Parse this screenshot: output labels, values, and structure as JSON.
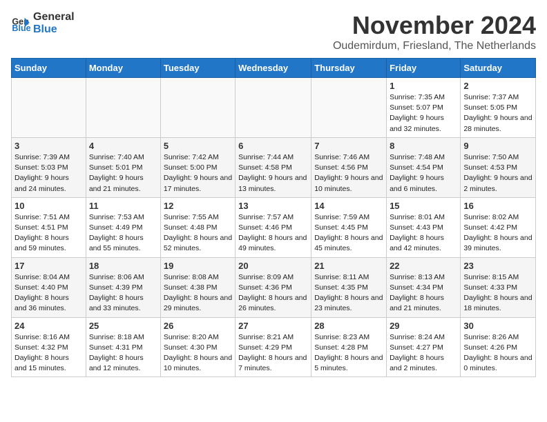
{
  "logo": {
    "line1": "General",
    "line2": "Blue"
  },
  "title": "November 2024",
  "subtitle": "Oudemirdum, Friesland, The Netherlands",
  "weekdays": [
    "Sunday",
    "Monday",
    "Tuesday",
    "Wednesday",
    "Thursday",
    "Friday",
    "Saturday"
  ],
  "weeks": [
    [
      {
        "day": "",
        "info": ""
      },
      {
        "day": "",
        "info": ""
      },
      {
        "day": "",
        "info": ""
      },
      {
        "day": "",
        "info": ""
      },
      {
        "day": "",
        "info": ""
      },
      {
        "day": "1",
        "info": "Sunrise: 7:35 AM\nSunset: 5:07 PM\nDaylight: 9 hours and 32 minutes."
      },
      {
        "day": "2",
        "info": "Sunrise: 7:37 AM\nSunset: 5:05 PM\nDaylight: 9 hours and 28 minutes."
      }
    ],
    [
      {
        "day": "3",
        "info": "Sunrise: 7:39 AM\nSunset: 5:03 PM\nDaylight: 9 hours and 24 minutes."
      },
      {
        "day": "4",
        "info": "Sunrise: 7:40 AM\nSunset: 5:01 PM\nDaylight: 9 hours and 21 minutes."
      },
      {
        "day": "5",
        "info": "Sunrise: 7:42 AM\nSunset: 5:00 PM\nDaylight: 9 hours and 17 minutes."
      },
      {
        "day": "6",
        "info": "Sunrise: 7:44 AM\nSunset: 4:58 PM\nDaylight: 9 hours and 13 minutes."
      },
      {
        "day": "7",
        "info": "Sunrise: 7:46 AM\nSunset: 4:56 PM\nDaylight: 9 hours and 10 minutes."
      },
      {
        "day": "8",
        "info": "Sunrise: 7:48 AM\nSunset: 4:54 PM\nDaylight: 9 hours and 6 minutes."
      },
      {
        "day": "9",
        "info": "Sunrise: 7:50 AM\nSunset: 4:53 PM\nDaylight: 9 hours and 2 minutes."
      }
    ],
    [
      {
        "day": "10",
        "info": "Sunrise: 7:51 AM\nSunset: 4:51 PM\nDaylight: 8 hours and 59 minutes."
      },
      {
        "day": "11",
        "info": "Sunrise: 7:53 AM\nSunset: 4:49 PM\nDaylight: 8 hours and 55 minutes."
      },
      {
        "day": "12",
        "info": "Sunrise: 7:55 AM\nSunset: 4:48 PM\nDaylight: 8 hours and 52 minutes."
      },
      {
        "day": "13",
        "info": "Sunrise: 7:57 AM\nSunset: 4:46 PM\nDaylight: 8 hours and 49 minutes."
      },
      {
        "day": "14",
        "info": "Sunrise: 7:59 AM\nSunset: 4:45 PM\nDaylight: 8 hours and 45 minutes."
      },
      {
        "day": "15",
        "info": "Sunrise: 8:01 AM\nSunset: 4:43 PM\nDaylight: 8 hours and 42 minutes."
      },
      {
        "day": "16",
        "info": "Sunrise: 8:02 AM\nSunset: 4:42 PM\nDaylight: 8 hours and 39 minutes."
      }
    ],
    [
      {
        "day": "17",
        "info": "Sunrise: 8:04 AM\nSunset: 4:40 PM\nDaylight: 8 hours and 36 minutes."
      },
      {
        "day": "18",
        "info": "Sunrise: 8:06 AM\nSunset: 4:39 PM\nDaylight: 8 hours and 33 minutes."
      },
      {
        "day": "19",
        "info": "Sunrise: 8:08 AM\nSunset: 4:38 PM\nDaylight: 8 hours and 29 minutes."
      },
      {
        "day": "20",
        "info": "Sunrise: 8:09 AM\nSunset: 4:36 PM\nDaylight: 8 hours and 26 minutes."
      },
      {
        "day": "21",
        "info": "Sunrise: 8:11 AM\nSunset: 4:35 PM\nDaylight: 8 hours and 23 minutes."
      },
      {
        "day": "22",
        "info": "Sunrise: 8:13 AM\nSunset: 4:34 PM\nDaylight: 8 hours and 21 minutes."
      },
      {
        "day": "23",
        "info": "Sunrise: 8:15 AM\nSunset: 4:33 PM\nDaylight: 8 hours and 18 minutes."
      }
    ],
    [
      {
        "day": "24",
        "info": "Sunrise: 8:16 AM\nSunset: 4:32 PM\nDaylight: 8 hours and 15 minutes."
      },
      {
        "day": "25",
        "info": "Sunrise: 8:18 AM\nSunset: 4:31 PM\nDaylight: 8 hours and 12 minutes."
      },
      {
        "day": "26",
        "info": "Sunrise: 8:20 AM\nSunset: 4:30 PM\nDaylight: 8 hours and 10 minutes."
      },
      {
        "day": "27",
        "info": "Sunrise: 8:21 AM\nSunset: 4:29 PM\nDaylight: 8 hours and 7 minutes."
      },
      {
        "day": "28",
        "info": "Sunrise: 8:23 AM\nSunset: 4:28 PM\nDaylight: 8 hours and 5 minutes."
      },
      {
        "day": "29",
        "info": "Sunrise: 8:24 AM\nSunset: 4:27 PM\nDaylight: 8 hours and 2 minutes."
      },
      {
        "day": "30",
        "info": "Sunrise: 8:26 AM\nSunset: 4:26 PM\nDaylight: 8 hours and 0 minutes."
      }
    ]
  ]
}
